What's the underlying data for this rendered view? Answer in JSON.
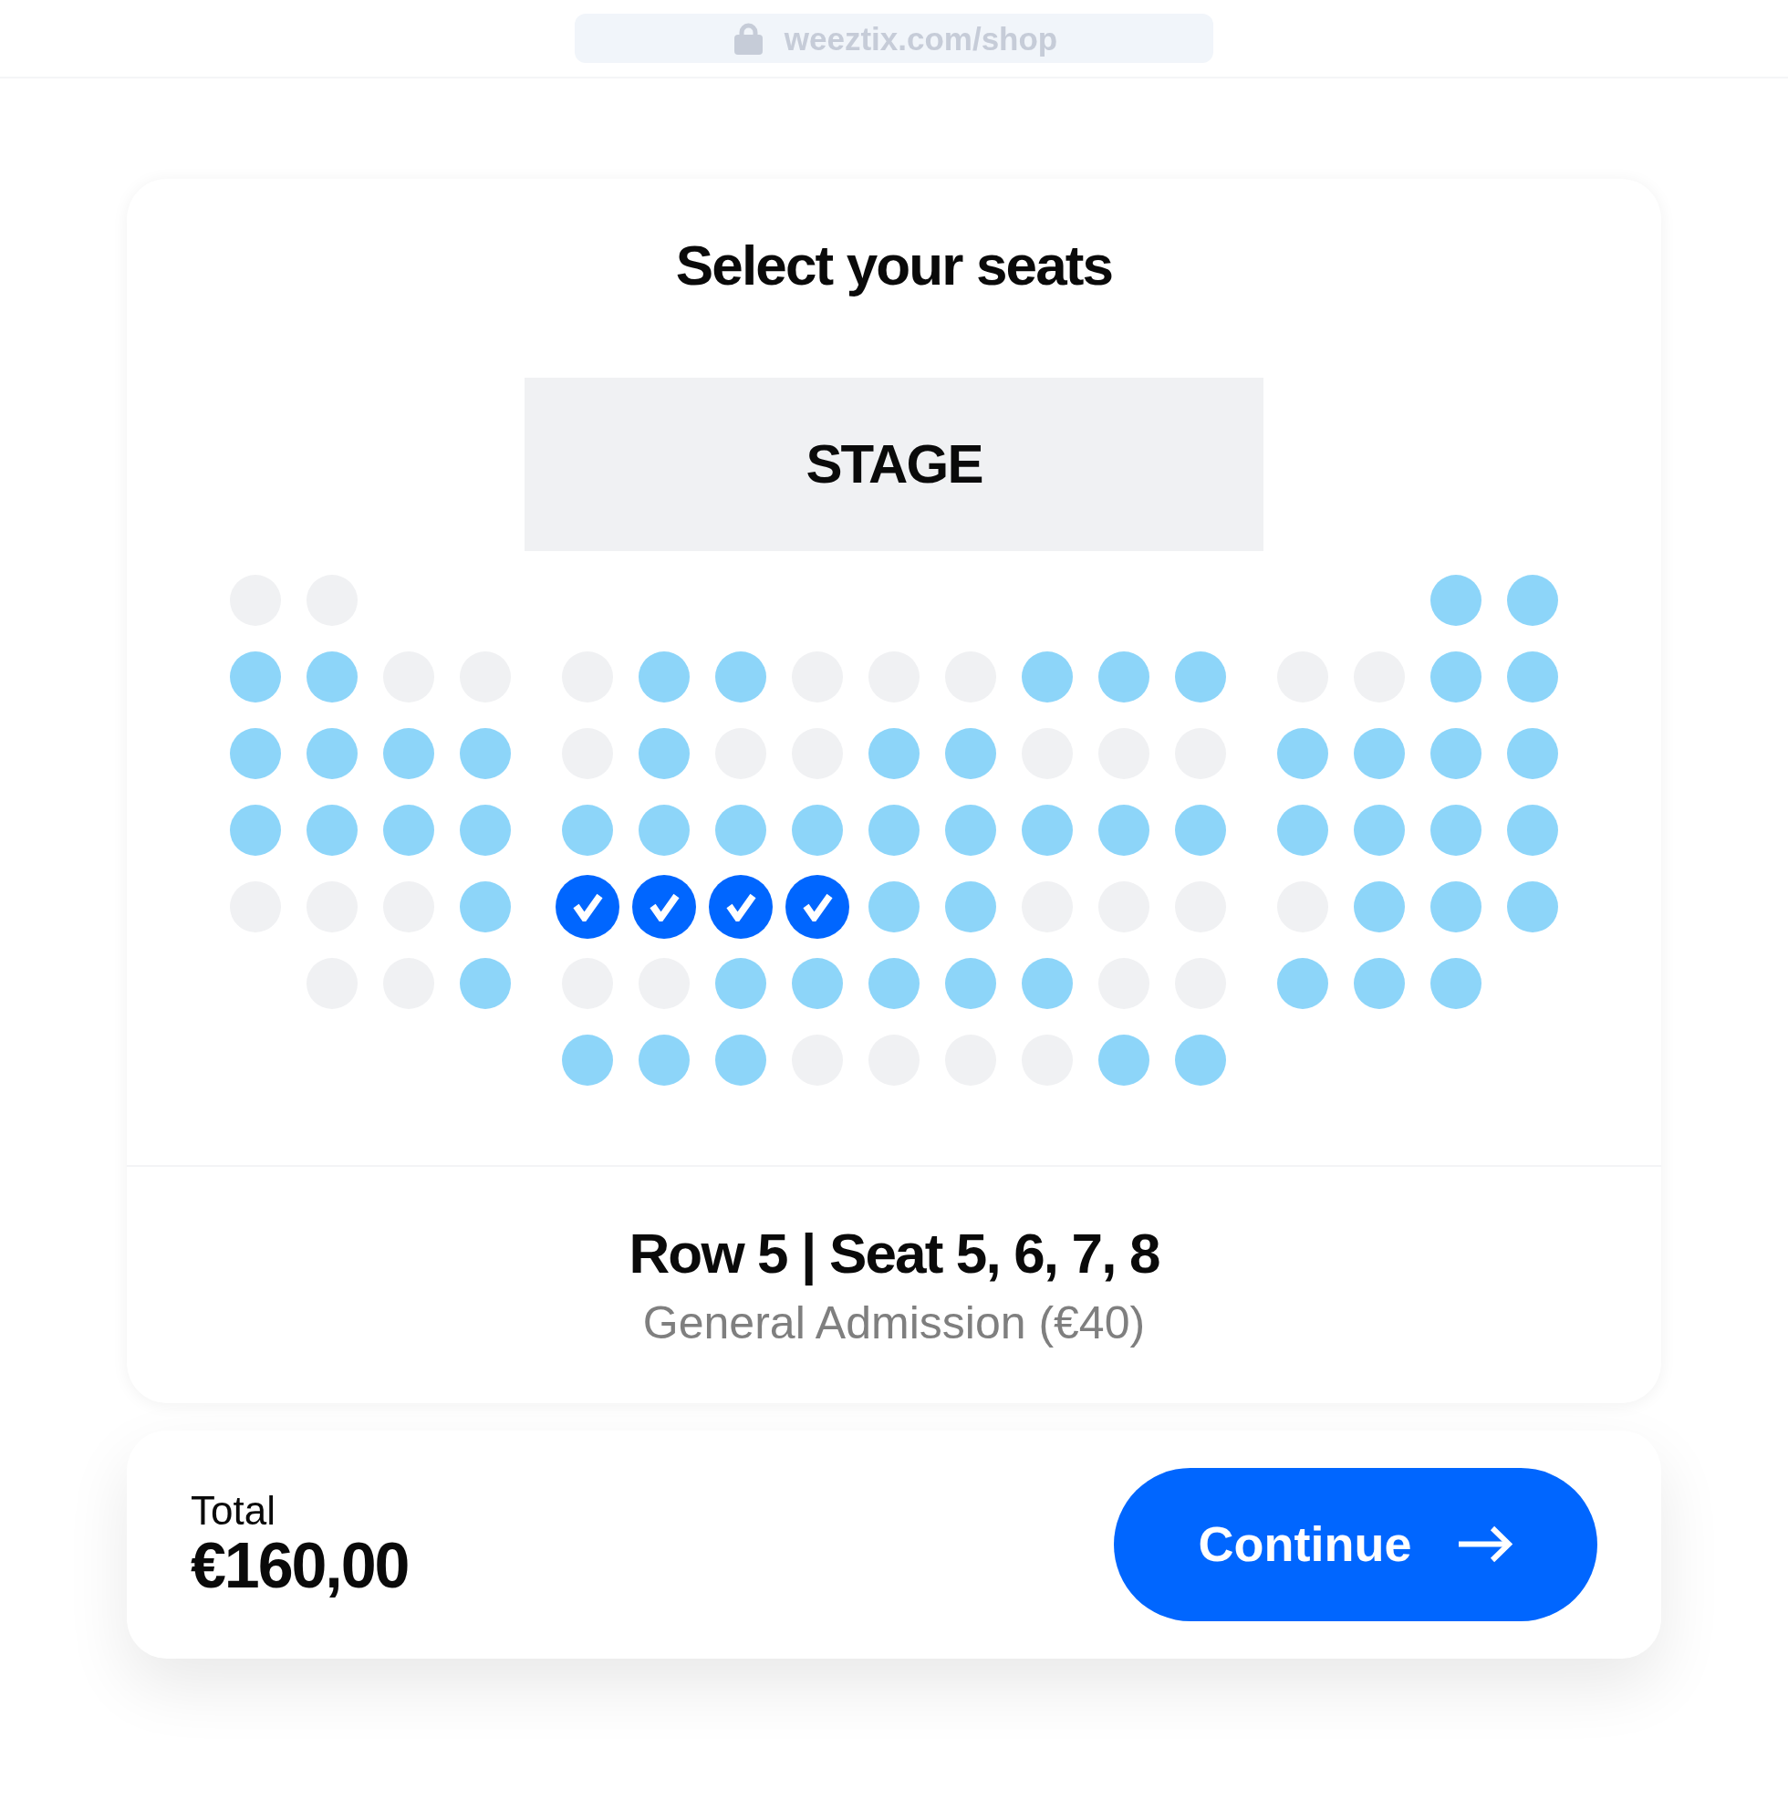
{
  "browser": {
    "url": "weeztix.com/shop"
  },
  "seat_picker": {
    "title": "Select your seats",
    "stage": "STAGE",
    "rows": [
      {
        "left": [
          {
            "kind": "seat",
            "available": false,
            "selected": false
          },
          {
            "kind": "seat",
            "available": false,
            "selected": false
          }
        ],
        "right": [
          {
            "kind": "gap"
          },
          {
            "kind": "gap"
          },
          {
            "kind": "seat",
            "available": true,
            "selected": false
          },
          {
            "kind": "seat",
            "available": true,
            "selected": false
          }
        ]
      },
      {
        "left": [
          {
            "kind": "seat",
            "available": true,
            "selected": false
          },
          {
            "kind": "seat",
            "available": true,
            "selected": false
          },
          {
            "kind": "seat",
            "available": false,
            "selected": false
          },
          {
            "kind": "seat",
            "available": false,
            "selected": false
          }
        ],
        "center": [
          {
            "kind": "seat",
            "available": false,
            "selected": false
          },
          {
            "kind": "seat",
            "available": true,
            "selected": false
          },
          {
            "kind": "seat",
            "available": true,
            "selected": false
          },
          {
            "kind": "seat",
            "available": false,
            "selected": false
          },
          {
            "kind": "seat",
            "available": false,
            "selected": false
          },
          {
            "kind": "seat",
            "available": false,
            "selected": false
          },
          {
            "kind": "seat",
            "available": true,
            "selected": false
          },
          {
            "kind": "seat",
            "available": true,
            "selected": false
          },
          {
            "kind": "seat",
            "available": true,
            "selected": false
          }
        ],
        "right": [
          {
            "kind": "seat",
            "available": false,
            "selected": false
          },
          {
            "kind": "seat",
            "available": false,
            "selected": false
          },
          {
            "kind": "seat",
            "available": true,
            "selected": false
          },
          {
            "kind": "seat",
            "available": true,
            "selected": false
          }
        ]
      },
      {
        "left": [
          {
            "kind": "seat",
            "available": true,
            "selected": false
          },
          {
            "kind": "seat",
            "available": true,
            "selected": false
          },
          {
            "kind": "seat",
            "available": true,
            "selected": false
          },
          {
            "kind": "seat",
            "available": true,
            "selected": false
          }
        ],
        "center": [
          {
            "kind": "seat",
            "available": false,
            "selected": false
          },
          {
            "kind": "seat",
            "available": true,
            "selected": false
          },
          {
            "kind": "seat",
            "available": false,
            "selected": false
          },
          {
            "kind": "seat",
            "available": false,
            "selected": false
          },
          {
            "kind": "seat",
            "available": true,
            "selected": false
          },
          {
            "kind": "seat",
            "available": true,
            "selected": false
          },
          {
            "kind": "seat",
            "available": false,
            "selected": false
          },
          {
            "kind": "seat",
            "available": false,
            "selected": false
          },
          {
            "kind": "seat",
            "available": false,
            "selected": false
          }
        ],
        "right": [
          {
            "kind": "seat",
            "available": true,
            "selected": false
          },
          {
            "kind": "seat",
            "available": true,
            "selected": false
          },
          {
            "kind": "seat",
            "available": true,
            "selected": false
          },
          {
            "kind": "seat",
            "available": true,
            "selected": false
          }
        ]
      },
      {
        "left": [
          {
            "kind": "seat",
            "available": true,
            "selected": false
          },
          {
            "kind": "seat",
            "available": true,
            "selected": false
          },
          {
            "kind": "seat",
            "available": true,
            "selected": false
          },
          {
            "kind": "seat",
            "available": true,
            "selected": false
          }
        ],
        "center": [
          {
            "kind": "seat",
            "available": true,
            "selected": false
          },
          {
            "kind": "seat",
            "available": true,
            "selected": false
          },
          {
            "kind": "seat",
            "available": true,
            "selected": false
          },
          {
            "kind": "seat",
            "available": true,
            "selected": false
          },
          {
            "kind": "seat",
            "available": true,
            "selected": false
          },
          {
            "kind": "seat",
            "available": true,
            "selected": false
          },
          {
            "kind": "seat",
            "available": true,
            "selected": false
          },
          {
            "kind": "seat",
            "available": true,
            "selected": false
          },
          {
            "kind": "seat",
            "available": true,
            "selected": false
          }
        ],
        "right": [
          {
            "kind": "seat",
            "available": true,
            "selected": false
          },
          {
            "kind": "seat",
            "available": true,
            "selected": false
          },
          {
            "kind": "seat",
            "available": true,
            "selected": false
          },
          {
            "kind": "seat",
            "available": true,
            "selected": false
          }
        ]
      },
      {
        "left": [
          {
            "kind": "seat",
            "available": false,
            "selected": false
          },
          {
            "kind": "seat",
            "available": false,
            "selected": false
          },
          {
            "kind": "seat",
            "available": false,
            "selected": false
          },
          {
            "kind": "seat",
            "available": true,
            "selected": false
          }
        ],
        "center": [
          {
            "kind": "seat",
            "available": true,
            "selected": true
          },
          {
            "kind": "seat",
            "available": true,
            "selected": true
          },
          {
            "kind": "seat",
            "available": true,
            "selected": true
          },
          {
            "kind": "seat",
            "available": true,
            "selected": true
          },
          {
            "kind": "seat",
            "available": true,
            "selected": false
          },
          {
            "kind": "seat",
            "available": true,
            "selected": false
          },
          {
            "kind": "seat",
            "available": false,
            "selected": false
          },
          {
            "kind": "seat",
            "available": false,
            "selected": false
          },
          {
            "kind": "seat",
            "available": false,
            "selected": false
          }
        ],
        "right": [
          {
            "kind": "seat",
            "available": false,
            "selected": false
          },
          {
            "kind": "seat",
            "available": true,
            "selected": false
          },
          {
            "kind": "seat",
            "available": true,
            "selected": false
          },
          {
            "kind": "seat",
            "available": true,
            "selected": false
          }
        ]
      },
      {
        "left": [
          {
            "kind": "gap"
          },
          {
            "kind": "seat",
            "available": false,
            "selected": false
          },
          {
            "kind": "seat",
            "available": false,
            "selected": false
          },
          {
            "kind": "seat",
            "available": true,
            "selected": false
          }
        ],
        "center": [
          {
            "kind": "seat",
            "available": false,
            "selected": false
          },
          {
            "kind": "seat",
            "available": false,
            "selected": false
          },
          {
            "kind": "seat",
            "available": true,
            "selected": false
          },
          {
            "kind": "seat",
            "available": true,
            "selected": false
          },
          {
            "kind": "seat",
            "available": true,
            "selected": false
          },
          {
            "kind": "seat",
            "available": true,
            "selected": false
          },
          {
            "kind": "seat",
            "available": true,
            "selected": false
          },
          {
            "kind": "seat",
            "available": false,
            "selected": false
          },
          {
            "kind": "seat",
            "available": false,
            "selected": false
          }
        ],
        "right": [
          {
            "kind": "seat",
            "available": true,
            "selected": false
          },
          {
            "kind": "seat",
            "available": true,
            "selected": false
          },
          {
            "kind": "seat",
            "available": true,
            "selected": false
          }
        ]
      },
      {
        "center": [
          {
            "kind": "seat",
            "available": true,
            "selected": false
          },
          {
            "kind": "seat",
            "available": true,
            "selected": false
          },
          {
            "kind": "seat",
            "available": true,
            "selected": false
          },
          {
            "kind": "seat",
            "available": false,
            "selected": false
          },
          {
            "kind": "seat",
            "available": false,
            "selected": false
          },
          {
            "kind": "seat",
            "available": false,
            "selected": false
          },
          {
            "kind": "seat",
            "available": false,
            "selected": false
          },
          {
            "kind": "seat",
            "available": true,
            "selected": false
          },
          {
            "kind": "seat",
            "available": true,
            "selected": false
          }
        ]
      }
    ],
    "selection": {
      "heading": "Row 5 | Seat 5, 6, 7, 8",
      "ticket_type": "General Admission (€40)"
    }
  },
  "checkout": {
    "total_label": "Total",
    "total": "€160,00",
    "button": "Continue"
  }
}
